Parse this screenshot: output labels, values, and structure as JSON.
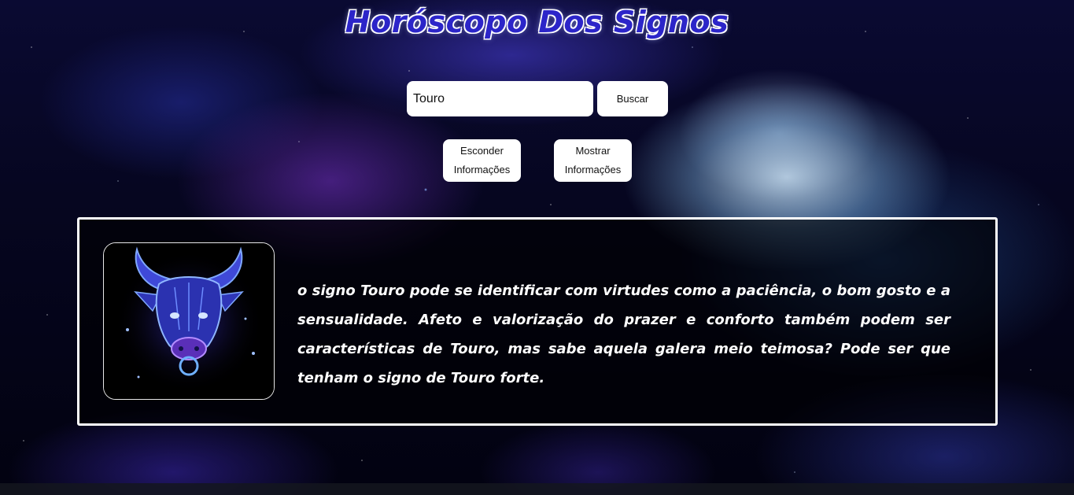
{
  "page": {
    "title": "Horóscopo Dos Signos"
  },
  "search": {
    "value": "Touro",
    "button_label": "Buscar"
  },
  "actions": {
    "hide_label": "Esconder Informações",
    "show_label": "Mostrar Informações"
  },
  "result": {
    "image_icon": "taurus-bull-icon",
    "description": "o signo Touro pode se identificar com virtudes como a paciência, o bom gosto e a sensualidade. Afeto e valorização do prazer e conforto também podem ser características de Touro, mas sabe aquela galera meio teimosa? Pode ser que tenham o signo de Touro forte."
  },
  "colors": {
    "title_fill": "#2c25c9",
    "title_outline": "#ffffff",
    "panel_border": "#ffffff",
    "icon_glow": "#3d4bff"
  }
}
